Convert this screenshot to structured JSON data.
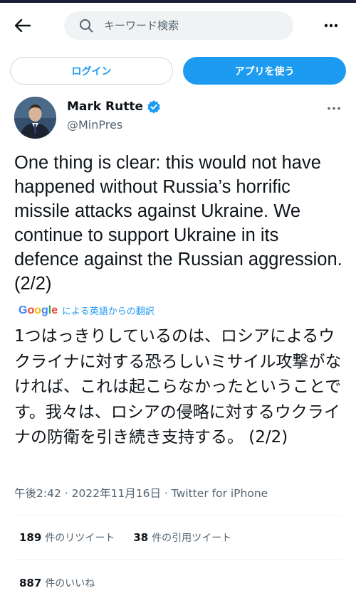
{
  "header": {
    "search_placeholder": "キーワード検索",
    "back_icon": "back-arrow-icon",
    "more_icon": "more-horizontal-icon"
  },
  "actions": {
    "login_label": "ログイン",
    "app_label": "アプリを使う"
  },
  "author": {
    "name": "Mark Rutte",
    "handle": "@MinPres",
    "verified": true
  },
  "tweet": {
    "text": "One thing is clear: this would not have happened without Russia’s horrific missile attacks against Ukraine. We continue to support Ukraine in its defence against the Russian aggression. (2/2)",
    "translate_label": "による英語からの翻訳",
    "translated_text": "1つはっきりしているのは、ロシアによるウクライナに対する恐ろしいミサイル攻撃がなければ、これは起こらなかったということです。我々は、ロシアの侵略に対するウクライナの防衛を引き続き支持する。 (2/2)",
    "meta": "午後2:42 · 2022年11月16日 · Twitter for iPhone"
  },
  "stats": {
    "retweets": "189",
    "retweets_label": "件のリツイート",
    "quotes": "38",
    "quotes_label": "件の引用ツイート",
    "likes": "887",
    "likes_label": "件のいいね"
  },
  "colors": {
    "accent": "#1d9bf0",
    "text": "#0f1419",
    "secondary": "#536471"
  }
}
